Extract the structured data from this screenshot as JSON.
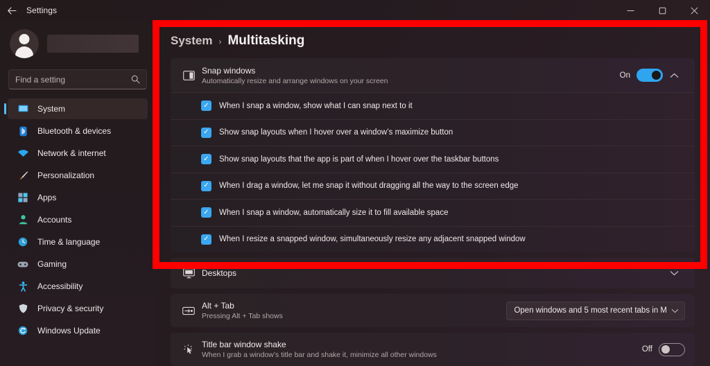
{
  "window": {
    "title": "Settings",
    "back_icon": "arrow-left-icon",
    "controls": [
      {
        "name": "minimize",
        "glyph": "─"
      },
      {
        "name": "maximize",
        "glyph": "☐"
      },
      {
        "name": "close",
        "glyph": "✕"
      }
    ]
  },
  "sidebar": {
    "account_name_redacted": "",
    "search": {
      "placeholder": "Find a setting",
      "icon": "search-icon"
    },
    "items": [
      {
        "label": "System",
        "icon": "monitor-icon",
        "active": true
      },
      {
        "label": "Bluetooth & devices",
        "icon": "bluetooth-icon",
        "active": false
      },
      {
        "label": "Network & internet",
        "icon": "wifi-icon",
        "active": false
      },
      {
        "label": "Personalization",
        "icon": "paintbrush-icon",
        "active": false
      },
      {
        "label": "Apps",
        "icon": "apps-grid-icon",
        "active": false
      },
      {
        "label": "Accounts",
        "icon": "person-icon",
        "active": false
      },
      {
        "label": "Time & language",
        "icon": "clock-icon",
        "active": false
      },
      {
        "label": "Gaming",
        "icon": "gamepad-icon",
        "active": false
      },
      {
        "label": "Accessibility",
        "icon": "accessibility-person-icon",
        "active": false
      },
      {
        "label": "Privacy & security",
        "icon": "shield-icon",
        "active": false
      },
      {
        "label": "Windows Update",
        "icon": "refresh-circle-icon",
        "active": false
      }
    ]
  },
  "breadcrumb": {
    "parent": "System",
    "separator": "›",
    "current": "Multitasking"
  },
  "snap_windows": {
    "icon": "snap-layout-icon",
    "title": "Snap windows",
    "subtitle": "Automatically resize and arrange windows on your screen",
    "toggle_state_label": "On",
    "toggle_on": true,
    "expand_chevron": "chevron-up-icon",
    "options": [
      {
        "label": "When I snap a window, show what I can snap next to it",
        "checked": true
      },
      {
        "label": "Show snap layouts when I hover over a window’s maximize button",
        "checked": true
      },
      {
        "label": "Show snap layouts that the app is part of when I hover over the taskbar buttons",
        "checked": true
      },
      {
        "label": "When I drag a window, let me snap it without dragging all the way to the screen edge",
        "checked": true
      },
      {
        "label": "When I snap a window, automatically size it to fill available space",
        "checked": true
      },
      {
        "label": "When I resize a snapped window, simultaneously resize any adjacent snapped window",
        "checked": true
      }
    ]
  },
  "desktops": {
    "icon": "desktops-icon",
    "title": "Desktops",
    "chevron": "chevron-down-icon"
  },
  "alt_tab": {
    "icon": "alt-tab-icon",
    "title": "Alt + Tab",
    "subtitle": "Pressing Alt + Tab shows",
    "dropdown_value": "Open windows and 5 most recent tabs in M",
    "dropdown_chevron": "chevron-down-icon"
  },
  "title_bar_shake": {
    "icon": "cursor-shake-icon",
    "title": "Title bar window shake",
    "subtitle": "When I grab a window’s title bar and shake it, minimize all other windows",
    "toggle_state_label": "Off",
    "toggle_on": false
  },
  "highlight": {
    "name": "red-annotation-box",
    "color": "#fe0000"
  },
  "checkmark_glyph": "✓"
}
